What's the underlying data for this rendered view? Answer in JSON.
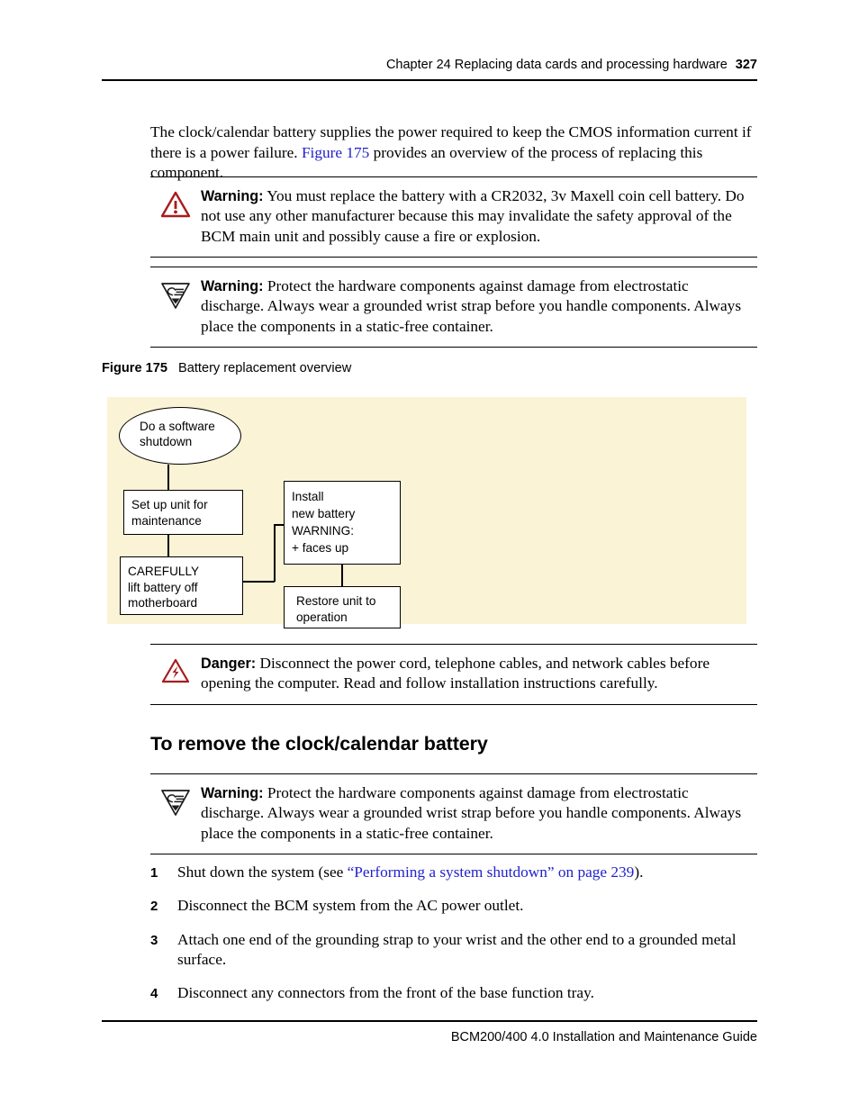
{
  "header": {
    "chapter": "Chapter 24  Replacing data cards and processing hardware",
    "page_number": "327"
  },
  "intro": {
    "text_before_link": "The clock/calendar battery supplies the power required to keep the CMOS information current if there is a power failure. ",
    "link_text": "Figure 175",
    "text_after_link": " provides an overview of the process of replacing this component."
  },
  "admonitions": [
    {
      "id": "warning-battery",
      "icon": "warning-triangle-icon",
      "label": "Warning:",
      "text": " You must replace the battery with a CR2032, 3v Maxell coin cell battery. Do not use any other manufacturer because this may invalidate the safety approval of the BCM main unit and possibly cause a fire or explosion."
    },
    {
      "id": "warning-esd-top",
      "icon": "esd-hand-icon",
      "label": "Warning:",
      "text": " Protect the hardware components against damage from electrostatic discharge. Always wear a grounded wrist strap before you handle components. Always place the components in a static-free container."
    },
    {
      "id": "danger-power",
      "icon": "danger-lightning-icon",
      "label": "Danger:",
      "text": " Disconnect the power cord, telephone cables, and network cables before opening the computer. Read and follow installation instructions carefully."
    },
    {
      "id": "warning-esd-bottom",
      "icon": "esd-hand-icon",
      "label": "Warning:",
      "text": " Protect the hardware components against damage from electrostatic discharge. Always wear a grounded wrist strap before you handle components. Always place the components in a static-free container."
    }
  ],
  "figure": {
    "number": "Figure 175",
    "title": "Battery replacement overview",
    "background_color": "#fbf3d5",
    "nodes": [
      {
        "id": "start",
        "shape": "oval",
        "lines": [
          "Do a software",
          "shutdown"
        ]
      },
      {
        "id": "setup",
        "shape": "box",
        "lines": [
          "Set up unit for",
          "maintenance"
        ]
      },
      {
        "id": "lift",
        "shape": "box",
        "lines": [
          "CAREFULLY",
          "lift battery off",
          "motherboard"
        ]
      },
      {
        "id": "install",
        "shape": "box",
        "lines": [
          "Install",
          "new battery",
          "WARNING:",
          "+ faces up"
        ]
      },
      {
        "id": "restore",
        "shape": "box",
        "lines": [
          "Restore unit to",
          "operation"
        ]
      }
    ]
  },
  "section": {
    "heading": "To remove the clock/calendar battery"
  },
  "steps": [
    {
      "num": "1",
      "before": "Shut down the system (see ",
      "link": "“Performing a system shutdown” on page 239",
      "after": ")."
    },
    {
      "num": "2",
      "before": "Disconnect the BCM system from the AC power outlet.",
      "link": "",
      "after": ""
    },
    {
      "num": "3",
      "before": "Attach one end of the grounding strap to your wrist and the other end to a grounded metal surface.",
      "link": "",
      "after": ""
    },
    {
      "num": "4",
      "before": "Disconnect any connectors from the front of the base function tray.",
      "link": "",
      "after": ""
    }
  ],
  "footer": {
    "text": "BCM200/400 4.0 Installation and Maintenance Guide"
  },
  "colors": {
    "link": "#2222cc",
    "warning_red": "#a81c1c",
    "figure_bg": "#fbf3d5"
  }
}
